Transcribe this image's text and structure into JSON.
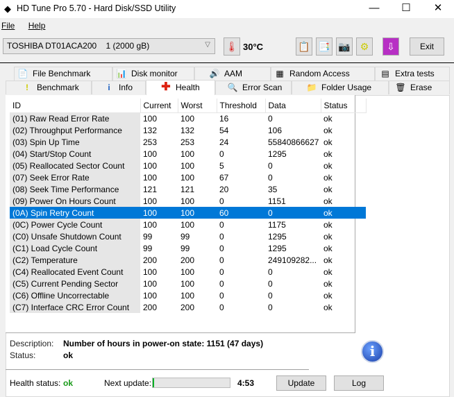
{
  "window": {
    "title": "HD Tune Pro 5.70 - Hard Disk/SSD Utility"
  },
  "menu": [
    "File",
    "Help"
  ],
  "toolbar": {
    "drive": "TOSHIBA DT01ACA200    1 (2000 gB)",
    "temperature": "30°C",
    "exit_label": "Exit"
  },
  "tabs_top": [
    "File Benchmark",
    "Disk monitor",
    "AAM",
    "Random Access",
    "Extra tests"
  ],
  "tabs_bottom": [
    "Benchmark",
    "Info",
    "Health",
    "Error Scan",
    "Folder Usage",
    "Erase"
  ],
  "active_tab": "Health",
  "table": {
    "columns": [
      "ID",
      "Current",
      "Worst",
      "Threshold",
      "Data",
      "Status"
    ],
    "selected_index": 8,
    "rows": [
      [
        "(01) Raw Read Error Rate",
        "100",
        "100",
        "16",
        "0",
        "ok"
      ],
      [
        "(02) Throughput Performance",
        "132",
        "132",
        "54",
        "106",
        "ok"
      ],
      [
        "(03) Spin Up Time",
        "253",
        "253",
        "24",
        "55840866627",
        "ok"
      ],
      [
        "(04) Start/Stop Count",
        "100",
        "100",
        "0",
        "1295",
        "ok"
      ],
      [
        "(05) Reallocated Sector Count",
        "100",
        "100",
        "5",
        "0",
        "ok"
      ],
      [
        "(07) Seek Error Rate",
        "100",
        "100",
        "67",
        "0",
        "ok"
      ],
      [
        "(08) Seek Time Performance",
        "121",
        "121",
        "20",
        "35",
        "ok"
      ],
      [
        "(09) Power On Hours Count",
        "100",
        "100",
        "0",
        "1151",
        "ok"
      ],
      [
        "(0A) Spin Retry Count",
        "100",
        "100",
        "60",
        "0",
        "ok"
      ],
      [
        "(0C) Power Cycle Count",
        "100",
        "100",
        "0",
        "1175",
        "ok"
      ],
      [
        "(C0) Unsafe Shutdown Count",
        "99",
        "99",
        "0",
        "1295",
        "ok"
      ],
      [
        "(C1) Load Cycle Count",
        "99",
        "99",
        "0",
        "1295",
        "ok"
      ],
      [
        "(C2) Temperature",
        "200",
        "200",
        "0",
        "249109282...",
        "ok"
      ],
      [
        "(C4) Reallocated Event Count",
        "100",
        "100",
        "0",
        "0",
        "ok"
      ],
      [
        "(C5) Current Pending Sector",
        "100",
        "100",
        "0",
        "0",
        "ok"
      ],
      [
        "(C6) Offline Uncorrectable",
        "100",
        "100",
        "0",
        "0",
        "ok"
      ],
      [
        "(C7) Interface CRC Error Count",
        "200",
        "200",
        "0",
        "0",
        "ok"
      ]
    ]
  },
  "details": {
    "description_label": "Description:",
    "description": "Number of hours in power-on state: 1151 (47 days)",
    "status_label": "Status:",
    "status": "ok"
  },
  "footer": {
    "health_label": "Health status:",
    "health": "ok",
    "next_update_label": "Next update:",
    "progress_percent": 2,
    "countdown": "4:53",
    "update_label": "Update",
    "log_label": "Log"
  },
  "colors": {
    "selection": "#0078d7",
    "ok_green": "#1a9a1a"
  }
}
